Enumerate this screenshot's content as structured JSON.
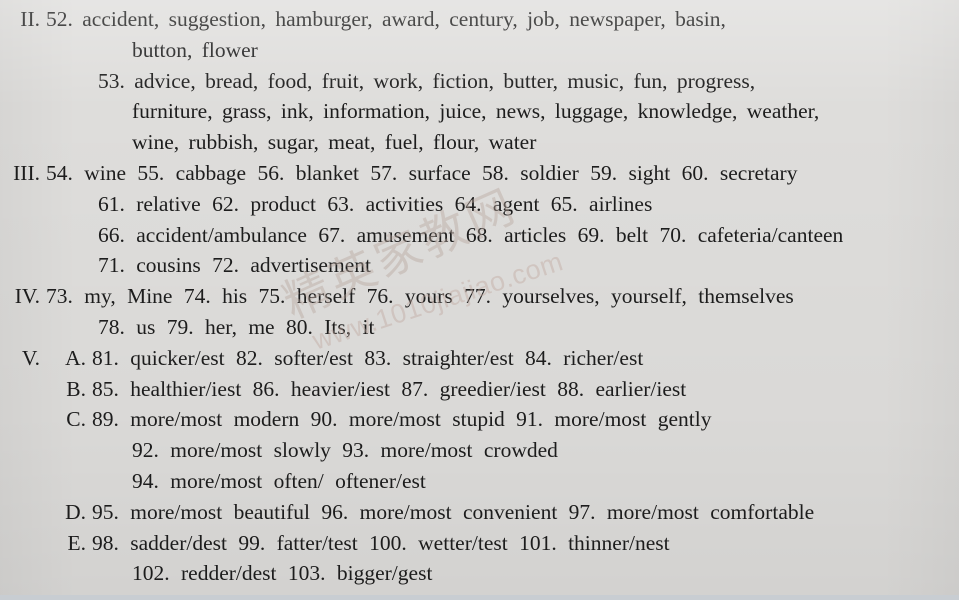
{
  "document": {
    "background_color": "#dedddb",
    "text_color": "#1d1d1d",
    "bottom_border_color": "#c8cdd2",
    "title": "Answer key page - sections II to V"
  },
  "watermark": {
    "chinese": "精英家教网",
    "url": "www.1010jiajiao.com",
    "color": "#b9a79f"
  },
  "sections": {
    "two": {
      "roman": "II.",
      "item52_line1": "52. accident, suggestion, hamburger, award, century, job, newspaper, basin,",
      "item52_line2": "button, flower",
      "item53_line1": "53. advice, bread, food, fruit, work, fiction, butter, music, fun, progress,",
      "item53_line2": "furniture, grass, ink, information, juice, news, luggage, knowledge, weather,",
      "item53_line3": "wine, rubbish, sugar, meat, fuel, flour, water"
    },
    "three": {
      "roman": "III.",
      "line1": "54. wine  55. cabbage  56. blanket  57. surface  58. soldier  59. sight  60. secretary",
      "line2": "61. relative  62. product  63. activities  64. agent  65. airlines",
      "line3": "66. accident/ambulance  67. amusement  68. articles  69. belt  70. cafeteria/canteen",
      "line4": "71. cousins  72. advertisement"
    },
    "four": {
      "roman": "IV.",
      "line1": "73. my, Mine  74. his  75. herself  76. yours  77. yourselves, yourself, themselves",
      "line2": "78. us  79. her, me  80. Its, it"
    },
    "five": {
      "roman": "V.",
      "groups": [
        {
          "letter": "A.",
          "lines": [
            "81. quicker/est  82. softer/est  83. straighter/est  84. richer/est"
          ]
        },
        {
          "letter": "B.",
          "lines": [
            "85. healthier/iest  86. heavier/iest  87. greedier/iest  88. earlier/iest"
          ]
        },
        {
          "letter": "C.",
          "lines": [
            "89. more/most modern  90. more/most stupid  91. more/most gently",
            "92. more/most slowly  93. more/most crowded",
            "94. more/most often/ oftener/est"
          ]
        },
        {
          "letter": "D.",
          "lines": [
            "95. more/most beautiful  96. more/most convenient  97. more/most comfortable"
          ]
        },
        {
          "letter": "E.",
          "lines": [
            "98. sadder/dest  99. fatter/test    100. wetter/test  101. thinner/nest",
            "102. redder/dest  103. bigger/gest"
          ]
        }
      ]
    }
  }
}
